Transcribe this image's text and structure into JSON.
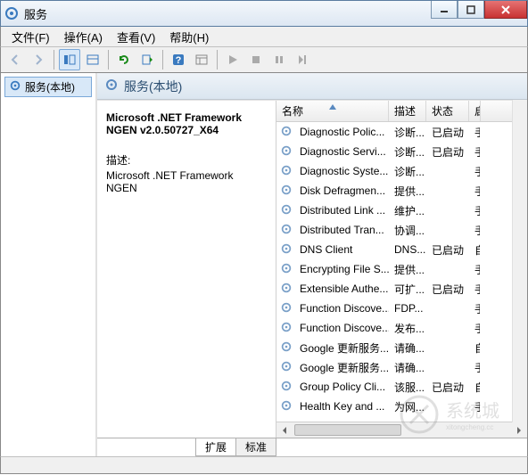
{
  "window": {
    "title": "服务"
  },
  "menu": {
    "file": "文件(F)",
    "action": "操作(A)",
    "view": "查看(V)",
    "help": "帮助(H)"
  },
  "tree": {
    "root": "服务(本地)"
  },
  "pane": {
    "header": "服务(本地)"
  },
  "detail": {
    "name": "Microsoft .NET Framework NGEN v2.0.50727_X64",
    "desc_label": "描述:",
    "desc": "Microsoft .NET Framework NGEN"
  },
  "columns": {
    "name": "名称",
    "desc": "描述",
    "status": "状态",
    "startup": "启"
  },
  "services": [
    {
      "name": "Diagnostic Polic...",
      "desc": "诊断...",
      "status": "已启动",
      "startup": "手"
    },
    {
      "name": "Diagnostic Servi...",
      "desc": "诊断...",
      "status": "已启动",
      "startup": "手"
    },
    {
      "name": "Diagnostic Syste...",
      "desc": "诊断...",
      "status": "",
      "startup": "手"
    },
    {
      "name": "Disk Defragmen...",
      "desc": "提供...",
      "status": "",
      "startup": "手"
    },
    {
      "name": "Distributed Link ...",
      "desc": "维护...",
      "status": "",
      "startup": "手"
    },
    {
      "name": "Distributed Tran...",
      "desc": "协调...",
      "status": "",
      "startup": "手"
    },
    {
      "name": "DNS Client",
      "desc": "DNS...",
      "status": "已启动",
      "startup": "自"
    },
    {
      "name": "Encrypting File S...",
      "desc": "提供...",
      "status": "",
      "startup": "手"
    },
    {
      "name": "Extensible Authe...",
      "desc": "可扩...",
      "status": "已启动",
      "startup": "手"
    },
    {
      "name": "Function Discove...",
      "desc": "FDP...",
      "status": "",
      "startup": "手"
    },
    {
      "name": "Function Discove...",
      "desc": "发布...",
      "status": "",
      "startup": "手"
    },
    {
      "name": "Google 更新服务...",
      "desc": "请确...",
      "status": "",
      "startup": "自"
    },
    {
      "name": "Google 更新服务...",
      "desc": "请确...",
      "status": "",
      "startup": "手"
    },
    {
      "name": "Group Policy Cli...",
      "desc": "该服...",
      "status": "已启动",
      "startup": "自"
    },
    {
      "name": "Health Key and ...",
      "desc": "为网...",
      "status": "",
      "startup": "手"
    }
  ],
  "tabs": {
    "extended": "扩展",
    "standard": "标准"
  },
  "watermark": "系统城"
}
